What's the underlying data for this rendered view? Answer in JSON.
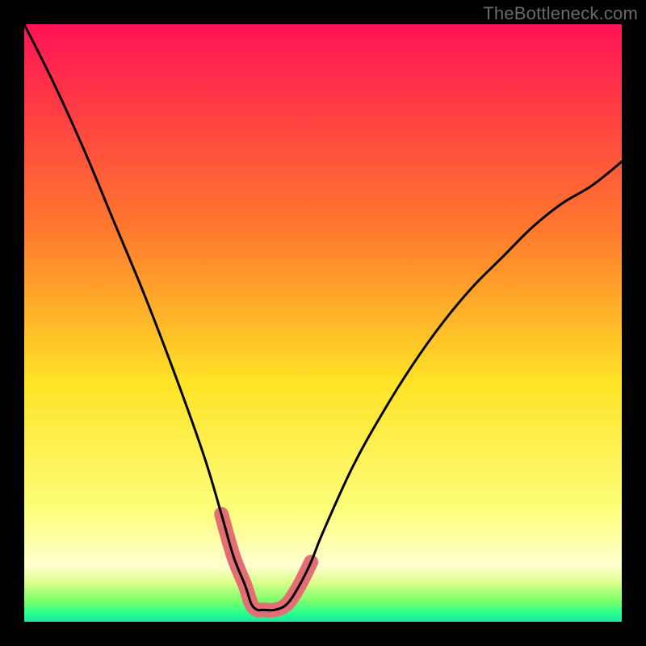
{
  "watermark": "TheBottleneck.com",
  "chart_data": {
    "type": "line",
    "title": "",
    "xlabel": "",
    "ylabel": "",
    "xlim": [
      0,
      100
    ],
    "ylim": [
      0,
      100
    ],
    "grid": false,
    "legend": false,
    "series": [
      {
        "name": "bottleneck-curve",
        "x": [
          0,
          5,
          10,
          15,
          20,
          25,
          30,
          33,
          35,
          37,
          38,
          39,
          40,
          42,
          44,
          46,
          48,
          50,
          55,
          60,
          65,
          70,
          75,
          80,
          85,
          90,
          95,
          100
        ],
        "values": [
          100,
          90,
          79,
          67,
          55,
          42,
          28,
          18,
          11,
          6,
          3,
          2,
          2,
          2,
          3,
          6,
          10,
          15,
          26,
          35,
          43,
          50,
          56,
          61,
          66,
          70,
          73,
          77
        ]
      }
    ],
    "annotations": [
      {
        "type": "highlight-segment",
        "name": "optimal-range-highlight",
        "x_range": [
          33,
          48
        ],
        "note": "thick pink overlay near minimum"
      }
    ],
    "background": {
      "type": "vertical-gradient",
      "stops": [
        {
          "pos": 0.0,
          "color": "#ff1254"
        },
        {
          "pos": 0.35,
          "color": "#ff7b2d"
        },
        {
          "pos": 0.6,
          "color": "#ffe326"
        },
        {
          "pos": 0.82,
          "color": "#fdff7e"
        },
        {
          "pos": 0.905,
          "color": "#ffffd0"
        },
        {
          "pos": 0.935,
          "color": "#d8ff8a"
        },
        {
          "pos": 0.965,
          "color": "#7bff6a"
        },
        {
          "pos": 0.985,
          "color": "#2cff8f"
        },
        {
          "pos": 1.0,
          "color": "#18e59a"
        }
      ]
    },
    "colors": {
      "curve": "#000000",
      "highlight": "#e36f74"
    }
  }
}
